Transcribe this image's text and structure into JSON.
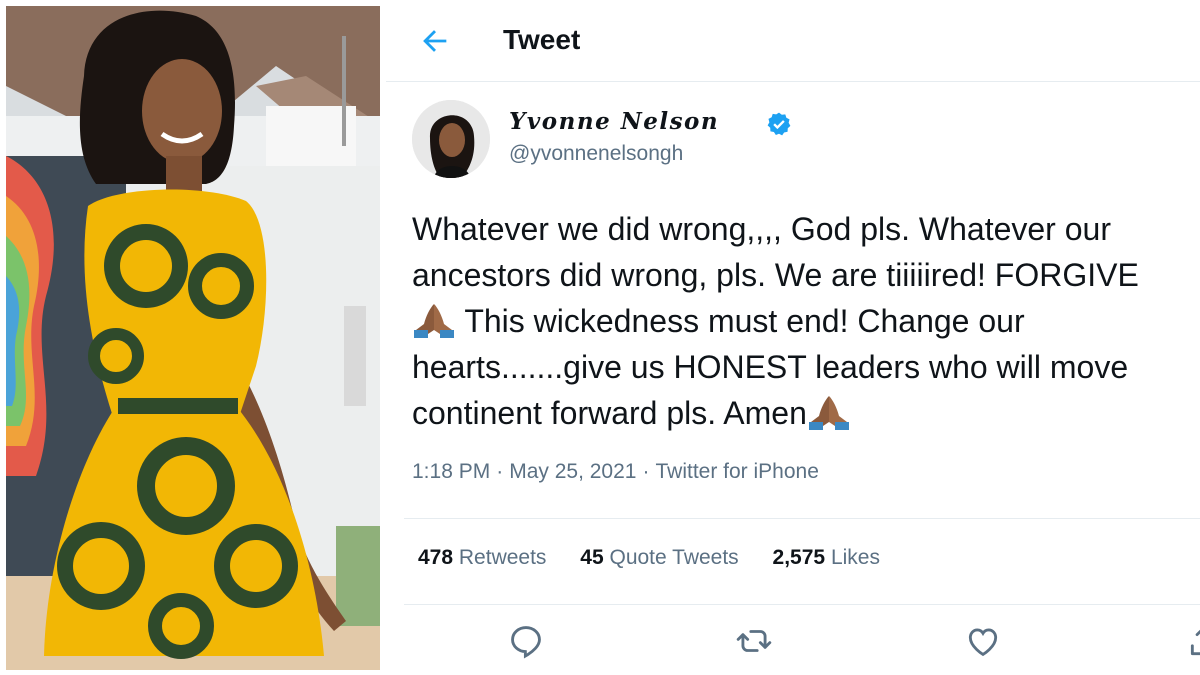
{
  "header": {
    "title": "Tweet"
  },
  "author": {
    "display_name": "Yvonne Nelson",
    "handle": "@yvonnenelsongh",
    "verified": true
  },
  "tweet": {
    "lines": [
      "Whatever we did wrong,,,, God pls. Whatever our",
      "ancestors did wrong, pls. We are tiiiiired! FORGIVE",
      "This wickedness must end! Change our",
      "hearts.......give us HONEST leaders who will move",
      "continent forward pls. Amen"
    ],
    "emoji": "folded-hands-emoji"
  },
  "meta": {
    "time": "1:18 PM",
    "date": "May 25, 2021",
    "client": "Twitter for iPhone",
    "separator": "·"
  },
  "stats": {
    "retweets_count": "478",
    "retweets_label": "Retweets",
    "quotes_count": "45",
    "quotes_label": "Quote Tweets",
    "likes_count": "2,575",
    "likes_label": "Likes"
  },
  "icons": {
    "back": "arrow-left-icon",
    "reply": "reply-icon",
    "retweet": "retweet-icon",
    "like": "heart-icon",
    "share": "share-icon",
    "verified": "verified-badge-icon"
  },
  "colors": {
    "accent": "#1da1f2",
    "secondary_text": "#5b7083",
    "primary_text": "#0f1419",
    "divider": "#e6ecf0",
    "dress_yellow": "#f2b705",
    "dress_green": "#2f4a2b"
  }
}
